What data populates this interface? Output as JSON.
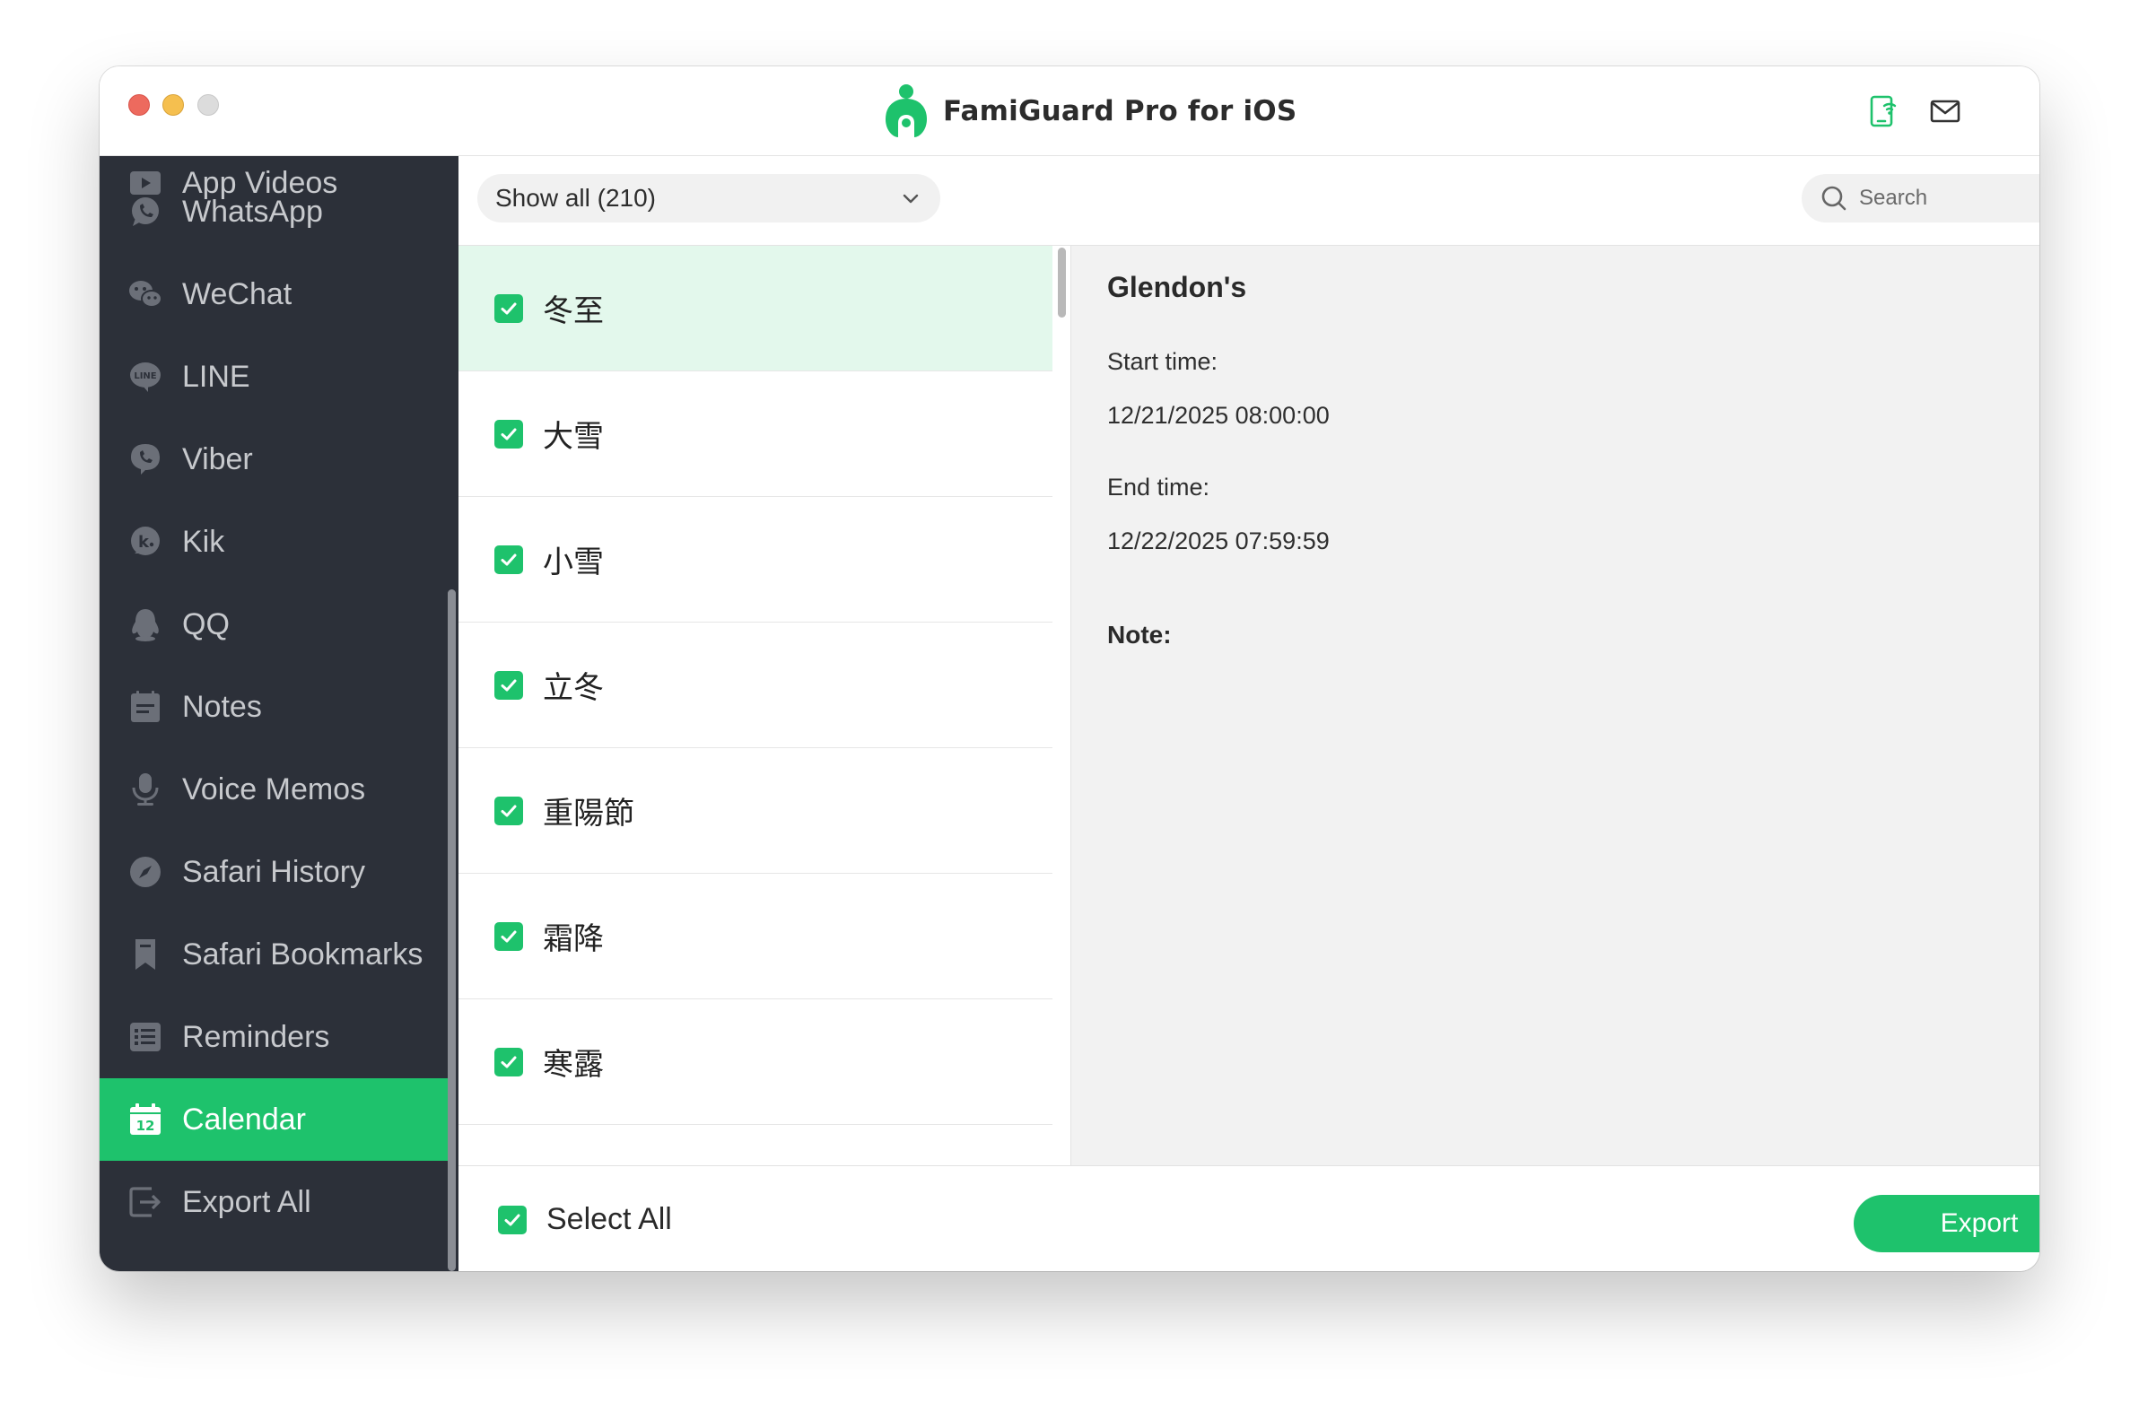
{
  "window": {
    "title": "FamiGuard Pro for iOS"
  },
  "colors": {
    "accent": "#1ec26c",
    "sidebar_bg": "#2c3039",
    "selected_row_bg": "#e3f8ec",
    "detail_bg": "#f2f2f2"
  },
  "toolbar": {
    "phone_icon": "phone-wifi-icon",
    "mail_icon": "mail-icon"
  },
  "sidebar": {
    "items": [
      {
        "label": "App Videos",
        "icon": "video-icon"
      },
      {
        "label": "WhatsApp",
        "icon": "whatsapp-icon"
      },
      {
        "label": "WeChat",
        "icon": "wechat-icon"
      },
      {
        "label": "LINE",
        "icon": "line-icon"
      },
      {
        "label": "Viber",
        "icon": "viber-icon"
      },
      {
        "label": "Kik",
        "icon": "kik-icon"
      },
      {
        "label": "QQ",
        "icon": "qq-icon"
      },
      {
        "label": "Notes",
        "icon": "notes-icon"
      },
      {
        "label": "Voice Memos",
        "icon": "microphone-icon"
      },
      {
        "label": "Safari History",
        "icon": "compass-icon"
      },
      {
        "label": "Safari Bookmarks",
        "icon": "bookmark-icon"
      },
      {
        "label": "Reminders",
        "icon": "list-icon"
      },
      {
        "label": "Calendar",
        "icon": "calendar-icon",
        "active": true,
        "icon_text": "12"
      },
      {
        "label": "Export All",
        "icon": "export-icon"
      }
    ]
  },
  "filter": {
    "selected": "Show all (210)"
  },
  "search": {
    "placeholder": "Search",
    "value": ""
  },
  "list": {
    "rows": [
      {
        "title": "冬至",
        "checked": true,
        "selected": true
      },
      {
        "title": "大雪",
        "checked": true
      },
      {
        "title": "小雪",
        "checked": true
      },
      {
        "title": "立冬",
        "checked": true
      },
      {
        "title": "重陽節",
        "checked": true
      },
      {
        "title": "霜降",
        "checked": true
      },
      {
        "title": "寒露",
        "checked": true
      }
    ]
  },
  "detail": {
    "title": "Glendon's",
    "start_label": "Start time:",
    "start_value": "12/21/2025 08:00:00",
    "end_label": "End time:",
    "end_value": "12/22/2025 07:59:59",
    "note_label": "Note:"
  },
  "footer": {
    "select_all_label": "Select All",
    "select_all_checked": true,
    "export_label": "Export"
  }
}
